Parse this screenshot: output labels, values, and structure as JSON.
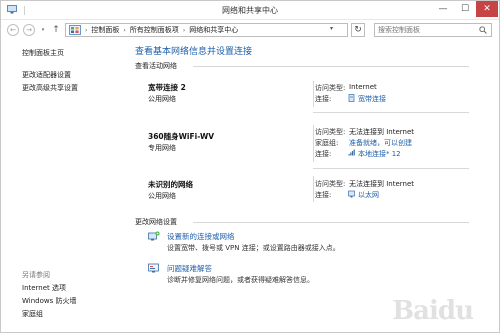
{
  "window": {
    "title": "网络和共享中心",
    "controls": {
      "minimize": "—",
      "maximize": "☐",
      "close": "✕"
    }
  },
  "nav": {
    "back_icon": "←",
    "forward_icon": "→",
    "recent_icon": "▾",
    "up_icon": "↑",
    "breadcrumbs": [
      "控制面板",
      "所有控制面板项",
      "网络和共享中心"
    ],
    "crumb_separator": "›",
    "dropdown_icon": "▾",
    "refresh_icon": "↻",
    "search_placeholder": "搜索控制面板"
  },
  "sidebar": {
    "home": "控制面板主页",
    "links": [
      "更改适配器设置",
      "更改高级共享设置"
    ],
    "see_also_heading": "另请参阅",
    "see_also": [
      "Internet 选项",
      "Windows 防火墙",
      "家庭组"
    ]
  },
  "main": {
    "title": "查看基本网络信息并设置连接",
    "active_heading": "查看活动网络",
    "networks": [
      {
        "name": "宽带连接  2",
        "type": "公用网络",
        "access_label": "访问类型:",
        "access_value": "Internet",
        "connection_label": "连接:",
        "connection_value": "宽带连接"
      },
      {
        "name": "360随身WiFi-WV",
        "type": "专用网络",
        "access_label": "访问类型:",
        "access_value": "无法连接到 Internet",
        "homegroup_label": "家庭组:",
        "homegroup_value": "准备就绪，可以创建",
        "connection_label": "连接:",
        "connection_value": "本地连接* 12"
      },
      {
        "name": "未识别的网络",
        "type": "公用网络",
        "access_label": "访问类型:",
        "access_value": "无法连接到 Internet",
        "connection_label": "连接:",
        "connection_value": "以太网"
      }
    ],
    "change_heading": "更改网络设置",
    "tasks": [
      {
        "link": "设置新的连接或网络",
        "desc": "设置宽带、拨号或 VPN 连接；或设置路由器或接入点。"
      },
      {
        "link": "问题疑难解答",
        "desc": "诊断并修复网络问题，或者获得疑难解答信息。"
      }
    ]
  },
  "watermark": "Baidu",
  "colors": {
    "link": "#1e5fa8",
    "close_button": "#c74444",
    "rule": "#d8d8d8"
  },
  "icons": [
    "network-center-icon",
    "control-panel-icon",
    "search-icon",
    "wifi-signal-icon",
    "ethernet-icon",
    "new-connection-icon",
    "troubleshoot-icon"
  ]
}
